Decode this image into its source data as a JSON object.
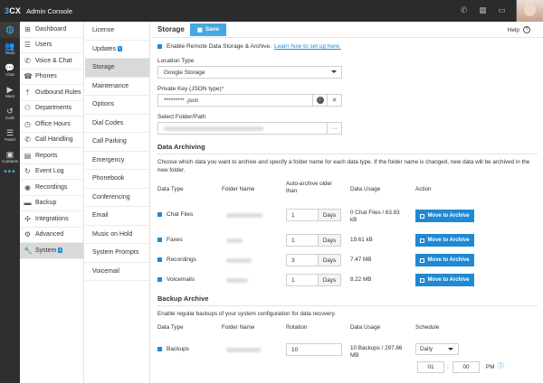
{
  "app": {
    "logo_left": "3",
    "logo_right": "CX",
    "title": "Admin Console"
  },
  "rail": {
    "items": [
      {
        "icon": "dashboard-app-icon",
        "label": ""
      },
      {
        "icon": "team-icon",
        "label": "Team"
      },
      {
        "icon": "chat-icon",
        "label": "Chat"
      },
      {
        "icon": "meet-icon",
        "label": "Meet"
      },
      {
        "icon": "calls-icon",
        "label": "Calls"
      },
      {
        "icon": "panel-icon",
        "label": "Panel"
      },
      {
        "icon": "contacts-icon",
        "label": "Contacts"
      }
    ]
  },
  "sidebar": {
    "items": [
      {
        "label": "Dashboard",
        "icon": "dashboard-icon"
      },
      {
        "label": "Users",
        "icon": "users-icon"
      },
      {
        "label": "Voice & Chat",
        "icon": "voice-chat-icon"
      },
      {
        "label": "Phones",
        "icon": "phones-icon"
      },
      {
        "label": "Outbound Rules",
        "icon": "outbound-rules-icon"
      },
      {
        "label": "Departments",
        "icon": "departments-icon"
      },
      {
        "label": "Office Hours",
        "icon": "office-hours-icon"
      },
      {
        "label": "Call Handling",
        "icon": "call-handling-icon"
      },
      {
        "label": "Reports",
        "icon": "reports-icon"
      },
      {
        "label": "Event Log",
        "icon": "event-log-icon"
      },
      {
        "label": "Recordings",
        "icon": "recordings-icon"
      },
      {
        "label": "Backup",
        "icon": "backup-icon"
      },
      {
        "label": "Integrations",
        "icon": "integrations-icon"
      },
      {
        "label": "Advanced",
        "icon": "advanced-icon"
      },
      {
        "label": "System",
        "icon": "system-icon",
        "badge": "2",
        "active": true
      }
    ]
  },
  "submenu": {
    "items": [
      {
        "label": "License"
      },
      {
        "label": "Updates",
        "badge": "1"
      },
      {
        "label": "Storage",
        "active": true
      },
      {
        "label": "Maintenance"
      },
      {
        "label": "Options"
      },
      {
        "label": "Dial Codes"
      },
      {
        "label": "Call Parking"
      },
      {
        "label": "Emergency"
      },
      {
        "label": "Phonebook"
      },
      {
        "label": "Conferencing"
      },
      {
        "label": "Email"
      },
      {
        "label": "Music on Hold"
      },
      {
        "label": "System Prompts"
      },
      {
        "label": "Voicemail"
      }
    ]
  },
  "header": {
    "title": "Storage",
    "save_label": "Save",
    "help_label": "Help"
  },
  "remote": {
    "enable_text": "Enable Remote Data Storage & Archive.",
    "link_text": "Learn how to set up here.",
    "location_label": "Location Type",
    "location_value": "Google Storage",
    "key_label": "Private Key (JSON type)",
    "key_required": "*",
    "key_value": "********* .json",
    "folder_label": "Select Folder/Path",
    "folder_button": "···"
  },
  "archiving": {
    "title": "Data Archiving",
    "description": "Choose which data you want to archive and specify a folder name for each data type. If the folder name is changed, new data will be archived in the new folder.",
    "columns": {
      "type": "Data Type",
      "folder": "Folder Name",
      "auto": "Auto-archive older than",
      "usage": "Data Usage",
      "action": "Action"
    },
    "rows": [
      {
        "type": "Chat Files",
        "days": "1",
        "unit": "Days",
        "usage": "0 Chat Files / 63.93 kB",
        "action": "Move to Archive"
      },
      {
        "type": "Faxes",
        "days": "1",
        "unit": "Days",
        "usage": "19.61 kB",
        "action": "Move to Archive"
      },
      {
        "type": "Recordings",
        "days": "3",
        "unit": "Days",
        "usage": "7.47 MB",
        "action": "Move to Archive"
      },
      {
        "type": "Voicemails",
        "days": "1",
        "unit": "Days",
        "usage": "8.22 MB",
        "action": "Move to Archive"
      }
    ]
  },
  "backup": {
    "title": "Backup Archive",
    "description": "Enable regular backups of your system configuration for data recovery.",
    "columns": {
      "type": "Data Type",
      "folder": "Folder Name",
      "rotation": "Rotation",
      "usage": "Data Usage",
      "schedule": "Schedule"
    },
    "row": {
      "type": "Backups",
      "rotation": "10",
      "usage": "10 Backups / 297.86 MB",
      "schedule": "Daily",
      "hour": "01",
      "minute": "00",
      "ampm": "PM",
      "sep": ":"
    }
  },
  "colors": {
    "accent": "#2089d3",
    "save": "#45a7e3",
    "topbar": "#2b2b2b",
    "rail": "#2f2f2f"
  }
}
